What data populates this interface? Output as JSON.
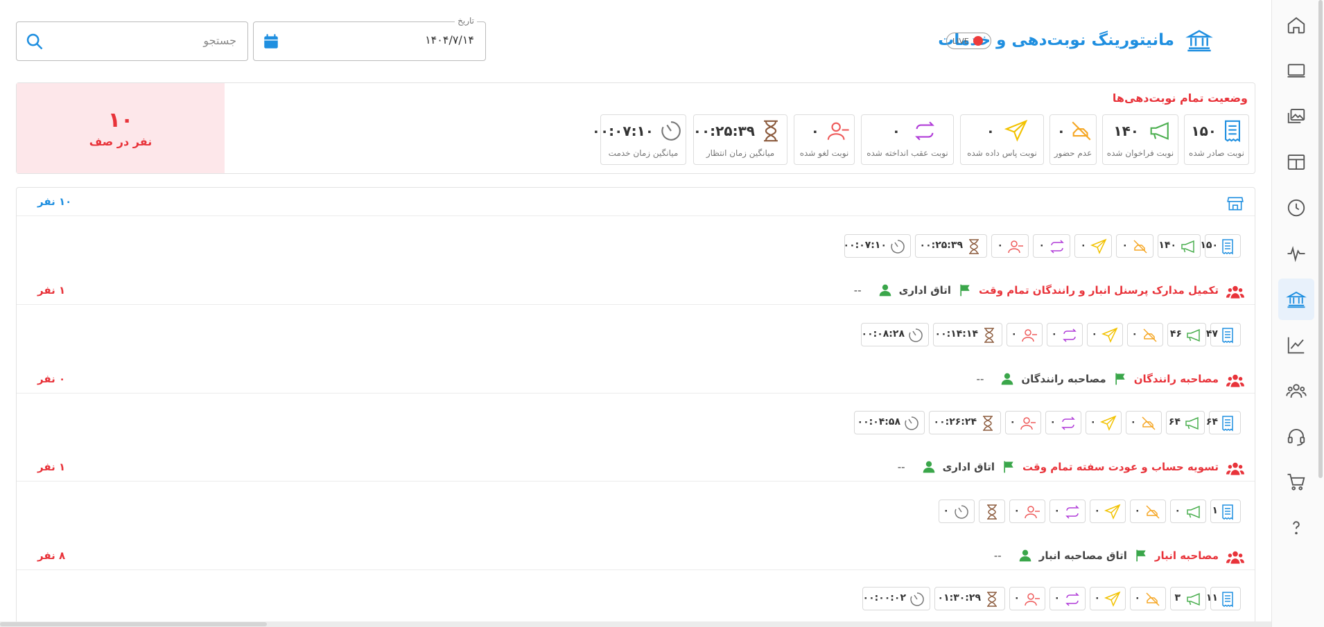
{
  "header": {
    "title": "مانیتورینگ نوبت‌دهی و خدمات",
    "live_label": "LIVE",
    "date_legend": "تاریخ",
    "date_value": "۱۴۰۴/۷/۱۴",
    "search_placeholder": "جستجو"
  },
  "summary": {
    "title": "وضعیت تمام نوبت‌دهی‌ها",
    "queue_count": "۱۰",
    "queue_label": "نفر در صف",
    "stats": [
      {
        "value": "۱۵۰",
        "label": "نوبت صادر شده",
        "icon": "receipt-icon",
        "color": "#1f8fe0"
      },
      {
        "value": "۱۴۰",
        "label": "نوبت فراخوان شده",
        "icon": "megaphone-icon",
        "color": "#4caf50"
      },
      {
        "value": "۰",
        "label": "عدم حضور",
        "icon": "hand-off-icon",
        "color": "#f5a623"
      },
      {
        "value": "۰",
        "label": "نوبت پاس داده شده",
        "icon": "send-icon",
        "color": "#f2c200"
      },
      {
        "value": "۰",
        "label": "نوبت عقب انداخته شده",
        "icon": "repeat-icon",
        "color": "#b03bd8"
      },
      {
        "value": "۰",
        "label": "نوبت لغو شده",
        "icon": "user-minus-icon",
        "color": "#ee5a5a"
      },
      {
        "value": "۰۰:۲۵:۳۹",
        "label": "میانگین زمان انتظار",
        "icon": "hourglass-icon",
        "color": "#8b5a3c"
      },
      {
        "value": "۰۰:۰۷:۱۰",
        "label": "میانگین زمان خدمت",
        "icon": "timer-icon",
        "color": "#777777"
      }
    ]
  },
  "groups": [
    {
      "count": "۱۰  نفر",
      "count_color": "#1f8fe0",
      "icon": "store-icon",
      "service": "",
      "room": "",
      "chips": [
        "۱۵۰",
        "۱۴۰",
        "۰",
        "۰",
        "۰",
        "۰",
        "۰۰:۲۵:۳۹",
        "۰۰:۰۷:۱۰"
      ]
    },
    {
      "count": "۱  نفر",
      "count_color": "#e8333a",
      "icon": "users-icon",
      "service": "تکمیل مدارک پرسنل انبار و رانندگان تمام وقت",
      "room": "اتاق اداری",
      "dash": "--",
      "chips": [
        "۴۷",
        "۴۶",
        "۰",
        "۰",
        "۰",
        "۰",
        "۰۰:۱۴:۱۴",
        "۰۰:۰۸:۲۸"
      ]
    },
    {
      "count": "۰  نفر",
      "count_color": "#e8333a",
      "icon": "users-icon",
      "service": "مصاحبه رانندگان",
      "room": "مصاحبه رانندگان",
      "dash": "--",
      "chips": [
        "۶۴",
        "۶۴",
        "۰",
        "۰",
        "۰",
        "۰",
        "۰۰:۲۶:۲۴",
        "۰۰:۰۴:۵۸"
      ]
    },
    {
      "count": "۱  نفر",
      "count_color": "#e8333a",
      "icon": "users-icon",
      "service": "تسویه حساب و عودت سفته تمام وقت",
      "room": "اتاق اداری",
      "dash": "--",
      "chips": [
        "۱",
        "۰",
        "۰",
        "۰",
        "۰",
        "۰",
        "",
        "۰"
      ]
    },
    {
      "count": "۸  نفر",
      "count_color": "#e8333a",
      "icon": "users-icon",
      "service": "مصاحبه انبار",
      "room": "اتاق مصاحبه انبار",
      "dash": "--",
      "chips": [
        "۱۱",
        "۳",
        "۰",
        "۰",
        "۰",
        "۰",
        "۰۱:۳۰:۲۹",
        "۰۰:۰۰:۰۲"
      ]
    }
  ],
  "sidebar": {
    "items": [
      {
        "name": "home-icon"
      },
      {
        "name": "monitor-icon"
      },
      {
        "name": "gallery-icon"
      },
      {
        "name": "layout-icon"
      },
      {
        "name": "clock-icon"
      },
      {
        "name": "activity-icon"
      },
      {
        "name": "bank-icon",
        "active": true
      },
      {
        "name": "chart-icon"
      },
      {
        "name": "users-icon"
      },
      {
        "name": "headset-icon"
      },
      {
        "name": "cart-icon"
      },
      {
        "name": "help-icon"
      }
    ]
  },
  "colors": {
    "primary": "#1f8fe0",
    "danger": "#e8333a",
    "queue_bg": "#fde7ea",
    "flag": "#3aa64a"
  }
}
